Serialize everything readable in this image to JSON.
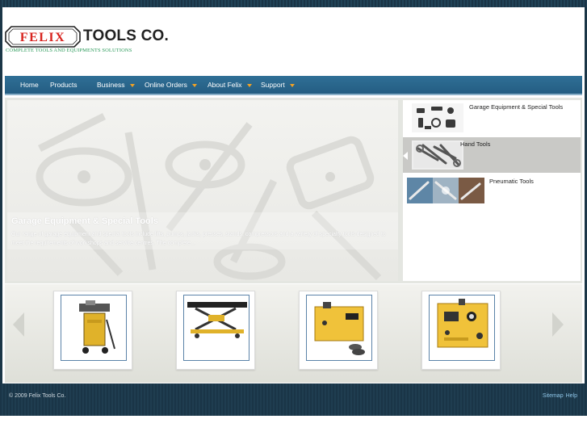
{
  "brand": {
    "badge_text": "FELIX",
    "name": "TOOLS CO.",
    "tagline": "COMPLETE TOOLS AND EQUIPMENTS SOLUTIONS",
    "badge_color": "#d8241f"
  },
  "nav": {
    "items": [
      {
        "label": "Home"
      },
      {
        "label": "Products"
      },
      {
        "label": "Business"
      },
      {
        "label": "Online Orders"
      },
      {
        "label": "About Felix"
      },
      {
        "label": "Support"
      }
    ],
    "bg_color": "#2b6890",
    "caret_color": "#f2a224"
  },
  "feature": {
    "title": "Garage Equipment & Special Tools",
    "description": "Our range of garage equipment and special tools include lifts, pumps, jacks, presses, stands, compressors and a variety of specialty tools designed to meet the requirements of workshops and service centres. The complete..."
  },
  "categories": [
    {
      "label": "Garage Equipment & Special Tools",
      "icon": "garage-tools-thumbnail",
      "active": false
    },
    {
      "label": "Hand Tools",
      "icon": "hand-tools-thumbnail",
      "active": true
    },
    {
      "label": "Pneumatic Tools",
      "icon": "pneumatic-tools-thumbnail",
      "active": false
    }
  ],
  "products": [
    {
      "icon": "yellow-tool-trolley"
    },
    {
      "icon": "motorcycle-lift-table"
    },
    {
      "icon": "yellow-battery-charger"
    },
    {
      "icon": "yellow-tester-panel"
    }
  ],
  "footer": {
    "copyright": "© 2009 Felix Tools Co.",
    "links": [
      "Sitemap",
      "Help"
    ]
  }
}
